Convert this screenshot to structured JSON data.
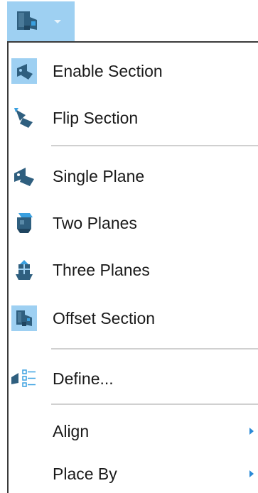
{
  "toolbar": {
    "split_button_icon": "offset-section-icon",
    "dropdown_icon": "chevron-down-icon"
  },
  "menu": {
    "items": [
      {
        "label": "Enable Section",
        "icon": "enable-section-icon",
        "highlighted_icon": true
      },
      {
        "label": "Flip Section",
        "icon": "flip-section-icon"
      },
      {
        "label": "Single Plane",
        "icon": "single-plane-icon"
      },
      {
        "label": "Two Planes",
        "icon": "two-planes-icon"
      },
      {
        "label": "Three Planes",
        "icon": "three-planes-icon"
      },
      {
        "label": "Offset Section",
        "icon": "offset-section-icon"
      },
      {
        "label": "Define...",
        "icon": "define-icon"
      },
      {
        "label": "Align",
        "icon": "submenu-arrow-icon",
        "has_submenu": true
      },
      {
        "label": "Place By",
        "icon": "submenu-arrow-icon",
        "has_submenu": true
      }
    ]
  },
  "colors": {
    "highlight": "#9ed0f2",
    "icon_primary": "#2f5f7f",
    "icon_accent": "#3aa0e0",
    "submenu_arrow": "#2a8ad6"
  }
}
